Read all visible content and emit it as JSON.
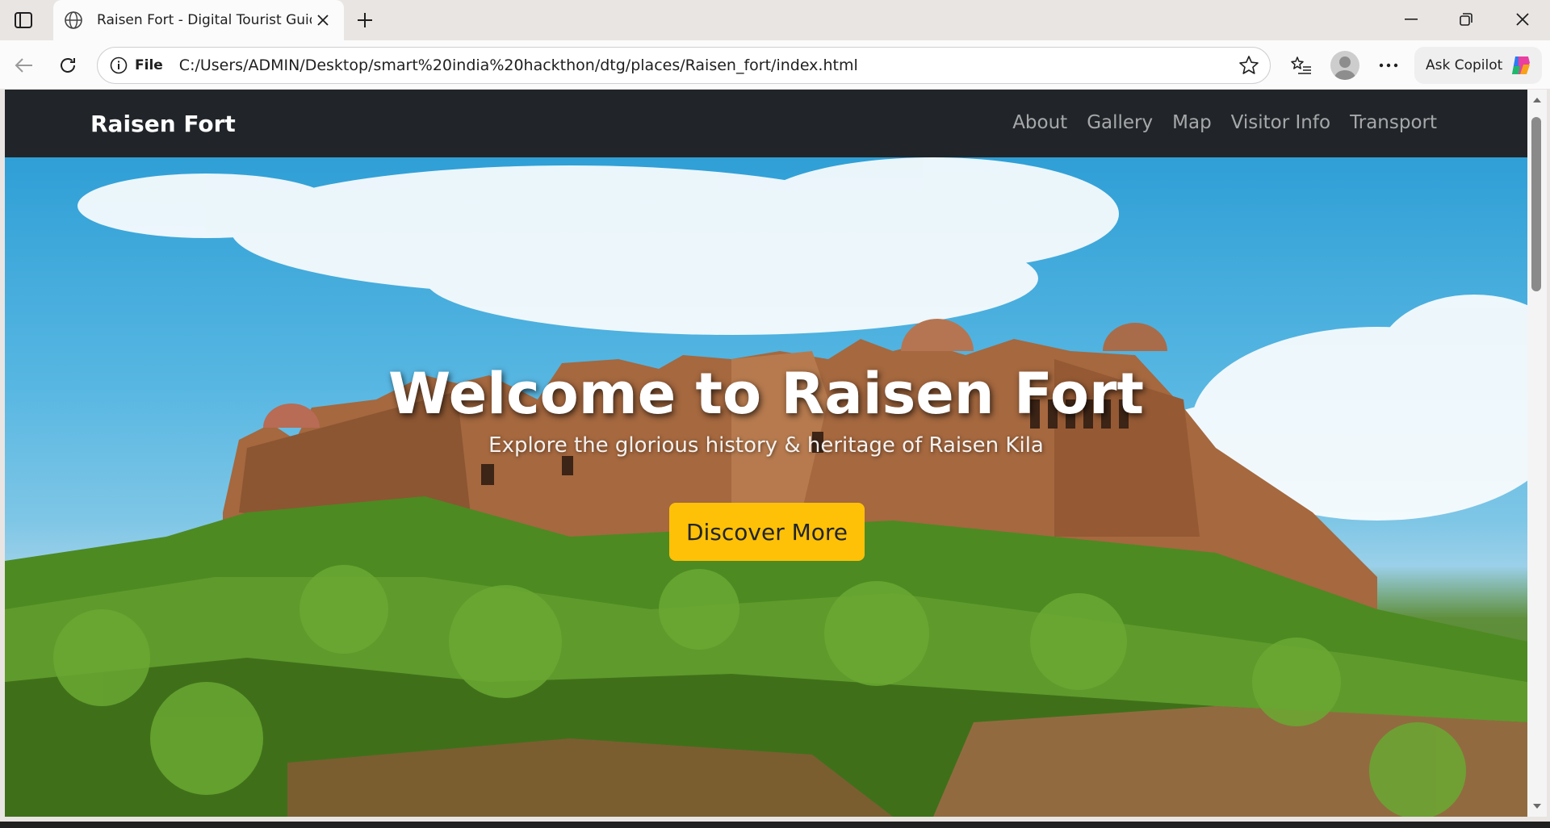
{
  "browser": {
    "tab": {
      "title": "Raisen Fort - Digital Tourist Guider"
    },
    "address": {
      "scheme": "File",
      "url": "C:/Users/ADMIN/Desktop/smart%20india%20hackthon/dtg/places/Raisen_fort/index.html"
    },
    "copilot_label": "Ask Copilot"
  },
  "site": {
    "brand": "Raisen Fort",
    "nav": [
      "About",
      "Gallery",
      "Map",
      "Visitor Info",
      "Transport"
    ],
    "hero": {
      "title": "Welcome to Raisen Fort",
      "subtitle": "Explore the glorious history & heritage of Raisen Kila",
      "button": "Discover More"
    }
  },
  "colors": {
    "navbar_bg": "#212529",
    "button_bg": "#ffc107",
    "sky": "#2f9fd6"
  }
}
